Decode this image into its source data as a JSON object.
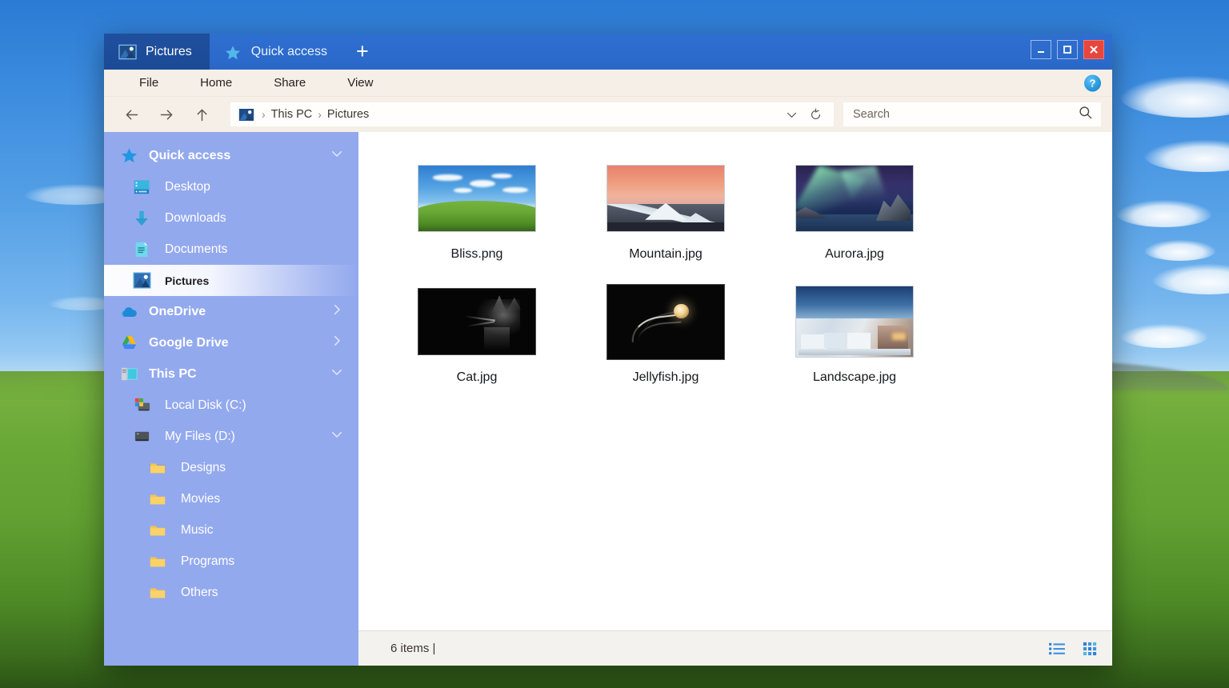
{
  "desktop": {
    "wallpaper_name": "bliss-wallpaper"
  },
  "window": {
    "tabs": [
      {
        "label": "Pictures",
        "icon": "picture-icon",
        "active": true
      },
      {
        "label": "Quick access",
        "icon": "star-icon",
        "active": false
      }
    ],
    "new_tab_label": "+",
    "controls": {
      "minimize_label": "—",
      "maximize_label": "□",
      "close_label": "×",
      "close_color": "#e8453c"
    }
  },
  "menubar": {
    "items": [
      "File",
      "Home",
      "Share",
      "View"
    ],
    "help_label": "?"
  },
  "navbar": {
    "back_label": "←",
    "forward_label": "→",
    "up_label": "↑",
    "breadcrumb": [
      "This PC",
      "Pictures"
    ],
    "breadcrumb_separator": "›",
    "history_dropdown_label": "⌄",
    "refresh_label": "↻"
  },
  "search": {
    "placeholder": "Search",
    "value": "",
    "icon": "search-icon"
  },
  "sidebar": {
    "items": [
      {
        "label": "Quick access",
        "icon": "star-icon",
        "indent": 0,
        "group": true,
        "chevron": "down",
        "selected": false
      },
      {
        "label": "Desktop",
        "icon": "desktop-icon",
        "indent": 1,
        "group": false,
        "chevron": "",
        "selected": false
      },
      {
        "label": "Downloads",
        "icon": "download-icon",
        "indent": 1,
        "group": false,
        "chevron": "",
        "selected": false
      },
      {
        "label": "Documents",
        "icon": "document-icon",
        "indent": 1,
        "group": false,
        "chevron": "",
        "selected": false
      },
      {
        "label": "Pictures",
        "icon": "picture-icon",
        "indent": 1,
        "group": false,
        "chevron": "",
        "selected": true
      },
      {
        "label": "OneDrive",
        "icon": "cloud-icon",
        "indent": 0,
        "group": true,
        "chevron": "right",
        "selected": false
      },
      {
        "label": "Google Drive",
        "icon": "google-drive-icon",
        "indent": 0,
        "group": true,
        "chevron": "right",
        "selected": false
      },
      {
        "label": "This PC",
        "icon": "computer-icon",
        "indent": 0,
        "group": true,
        "chevron": "down",
        "selected": false
      },
      {
        "label": "Local Disk (C:)",
        "icon": "system-drive-icon",
        "indent": 1,
        "group": false,
        "chevron": "",
        "selected": false
      },
      {
        "label": "My Files (D:)",
        "icon": "drive-icon",
        "indent": 1,
        "group": false,
        "chevron": "down",
        "selected": false
      },
      {
        "label": "Designs",
        "icon": "folder-icon",
        "indent": 2,
        "group": false,
        "chevron": "",
        "selected": false
      },
      {
        "label": "Movies",
        "icon": "folder-icon",
        "indent": 2,
        "group": false,
        "chevron": "",
        "selected": false
      },
      {
        "label": "Music",
        "icon": "folder-icon",
        "indent": 2,
        "group": false,
        "chevron": "",
        "selected": false
      },
      {
        "label": "Programs",
        "icon": "folder-icon",
        "indent": 2,
        "group": false,
        "chevron": "",
        "selected": false
      },
      {
        "label": "Others",
        "icon": "folder-icon",
        "indent": 2,
        "group": false,
        "chevron": "",
        "selected": false
      }
    ]
  },
  "files": [
    {
      "name": "Bliss.png",
      "art": "bliss"
    },
    {
      "name": "Mountain.jpg",
      "art": "mtn"
    },
    {
      "name": "Aurora.jpg",
      "art": "aurora"
    },
    {
      "name": "Cat.jpg",
      "art": "cat"
    },
    {
      "name": "Jellyfish.jpg",
      "art": "jelly"
    },
    {
      "name": "Landscape.jpg",
      "art": "land"
    }
  ],
  "statusbar": {
    "text": "6 items |",
    "list_view_icon": "list-view-icon",
    "grid_view_icon": "grid-view-icon"
  }
}
